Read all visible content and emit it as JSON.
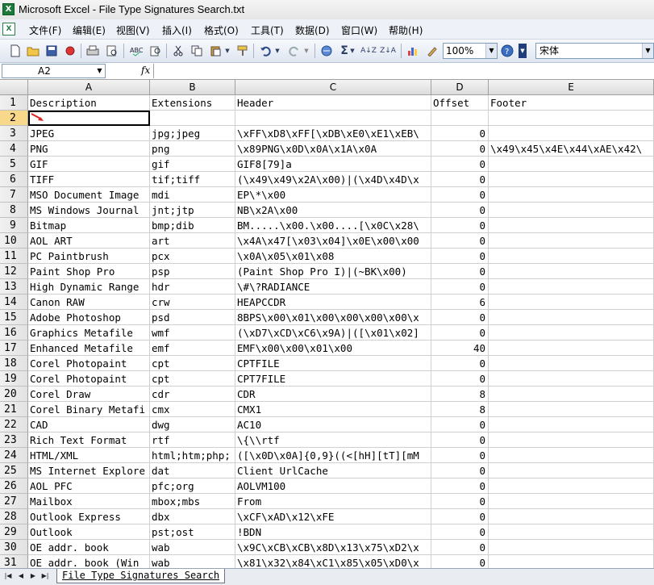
{
  "window": {
    "title": "Microsoft Excel - File Type Signatures Search.txt"
  },
  "menu": [
    "文件(F)",
    "编辑(E)",
    "视图(V)",
    "插入(I)",
    "格式(O)",
    "工具(T)",
    "数据(D)",
    "窗口(W)",
    "帮助(H)"
  ],
  "toolbar": {
    "zoom": "100%",
    "font": "宋体"
  },
  "formula_bar": {
    "cell_ref": "A2",
    "fx": "fx",
    "value": ""
  },
  "columns": [
    "A",
    "B",
    "C",
    "D",
    "E"
  ],
  "rows": [
    {
      "n": "1",
      "a": "Description",
      "b": "Extensions",
      "c": "Header",
      "d": "Offset",
      "e": "Footer"
    },
    {
      "n": "2",
      "a": "",
      "b": "",
      "c": "",
      "d": "",
      "e": ""
    },
    {
      "n": "3",
      "a": "JPEG",
      "b": "jpg;jpeg",
      "c": "\\xFF\\xD8\\xFF[\\xDB\\xE0\\xE1\\xEB\\",
      "d": "0",
      "e": ""
    },
    {
      "n": "4",
      "a": "PNG",
      "b": "png",
      "c": "\\x89PNG\\x0D\\x0A\\x1A\\x0A",
      "d": "0",
      "e": "\\x49\\x45\\x4E\\x44\\xAE\\x42\\"
    },
    {
      "n": "5",
      "a": "GIF",
      "b": "gif",
      "c": "GIF8[79]a",
      "d": "0",
      "e": ""
    },
    {
      "n": "6",
      "a": "TIFF",
      "b": "tif;tiff",
      "c": "(\\x49\\x49\\x2A\\x00)|(\\x4D\\x4D\\x",
      "d": "0",
      "e": ""
    },
    {
      "n": "7",
      "a": "MSO Document Image",
      "b": "mdi",
      "c": "EP\\*\\x00",
      "d": "0",
      "e": ""
    },
    {
      "n": "8",
      "a": "MS Windows Journal",
      "b": "jnt;jtp",
      "c": "NB\\x2A\\x00",
      "d": "0",
      "e": ""
    },
    {
      "n": "9",
      "a": "Bitmap",
      "b": "bmp;dib",
      "c": "BM.....\\x00.\\x00....[\\x0C\\x28\\",
      "d": "0",
      "e": ""
    },
    {
      "n": "10",
      "a": "AOL ART",
      "b": "art",
      "c": "\\x4A\\x47[\\x03\\x04]\\x0E\\x00\\x00",
      "d": "0",
      "e": ""
    },
    {
      "n": "11",
      "a": "PC Paintbrush",
      "b": "pcx",
      "c": "\\x0A\\x05\\x01\\x08",
      "d": "0",
      "e": ""
    },
    {
      "n": "12",
      "a": "Paint Shop Pro",
      "b": "psp",
      "c": "(Paint Shop Pro I)|(~BK\\x00)",
      "d": "0",
      "e": ""
    },
    {
      "n": "13",
      "a": "High Dynamic Range",
      "b": "hdr",
      "c": "\\#\\?RADIANCE",
      "d": "0",
      "e": ""
    },
    {
      "n": "14",
      "a": "Canon RAW",
      "b": "crw",
      "c": "HEAPCCDR",
      "d": "6",
      "e": ""
    },
    {
      "n": "15",
      "a": "Adobe Photoshop",
      "b": "psd",
      "c": "8BPS\\x00\\x01\\x00\\x00\\x00\\x00\\x",
      "d": "0",
      "e": ""
    },
    {
      "n": "16",
      "a": "Graphics Metafile",
      "b": "wmf",
      "c": "(\\xD7\\xCD\\xC6\\x9A)|([\\x01\\x02]",
      "d": "0",
      "e": ""
    },
    {
      "n": "17",
      "a": "Enhanced Metafile",
      "b": "emf",
      "c": " EMF\\x00\\x00\\x01\\x00",
      "d": "40",
      "e": ""
    },
    {
      "n": "18",
      "a": "Corel Photopaint",
      "b": "cpt",
      "c": "CPTFILE",
      "d": "0",
      "e": ""
    },
    {
      "n": "19",
      "a": "Corel Photopaint",
      "b": "cpt",
      "c": "CPT7FILE",
      "d": "0",
      "e": ""
    },
    {
      "n": "20",
      "a": "Corel Draw",
      "b": "cdr",
      "c": "CDR",
      "d": "8",
      "e": ""
    },
    {
      "n": "21",
      "a": "Corel Binary Metafi",
      "b": "cmx",
      "c": "CMX1",
      "d": "8",
      "e": ""
    },
    {
      "n": "22",
      "a": "CAD",
      "b": "dwg",
      "c": "AC10",
      "d": "0",
      "e": ""
    },
    {
      "n": "23",
      "a": "Rich Text Format",
      "b": "rtf",
      "c": "\\{\\\\rtf",
      "d": "0",
      "e": ""
    },
    {
      "n": "24",
      "a": "HTML/XML",
      "b": "html;htm;php;",
      "c": "([\\x0D\\x0A]{0,9}((<[hH][tT][mM",
      "d": "0",
      "e": ""
    },
    {
      "n": "25",
      "a": "MS Internet Explore",
      "b": "dat",
      "c": "Client UrlCache",
      "d": "0",
      "e": ""
    },
    {
      "n": "26",
      "a": "AOL PFC",
      "b": "pfc;org",
      "c": "AOLVM100",
      "d": "0",
      "e": ""
    },
    {
      "n": "27",
      "a": "Mailbox",
      "b": "mbox;mbs",
      "c": "From",
      "d": "0",
      "e": ""
    },
    {
      "n": "28",
      "a": "Outlook Express",
      "b": "dbx",
      "c": "\\xCF\\xAD\\x12\\xFE",
      "d": "0",
      "e": ""
    },
    {
      "n": "29",
      "a": "Outlook",
      "b": "pst;ost",
      "c": "!BDN",
      "d": "0",
      "e": ""
    },
    {
      "n": "30",
      "a": "OE addr. book",
      "b": "wab",
      "c": "\\x9C\\xCB\\xCB\\x8D\\x13\\x75\\xD2\\x",
      "d": "0",
      "e": ""
    },
    {
      "n": "31",
      "a": "OE addr. book (Win",
      "b": "wab",
      "c": "\\x81\\x32\\x84\\xC1\\x85\\x05\\xD0\\x",
      "d": "0",
      "e": ""
    }
  ],
  "sheet_tab": {
    "label": "File Type Signatures Search"
  }
}
